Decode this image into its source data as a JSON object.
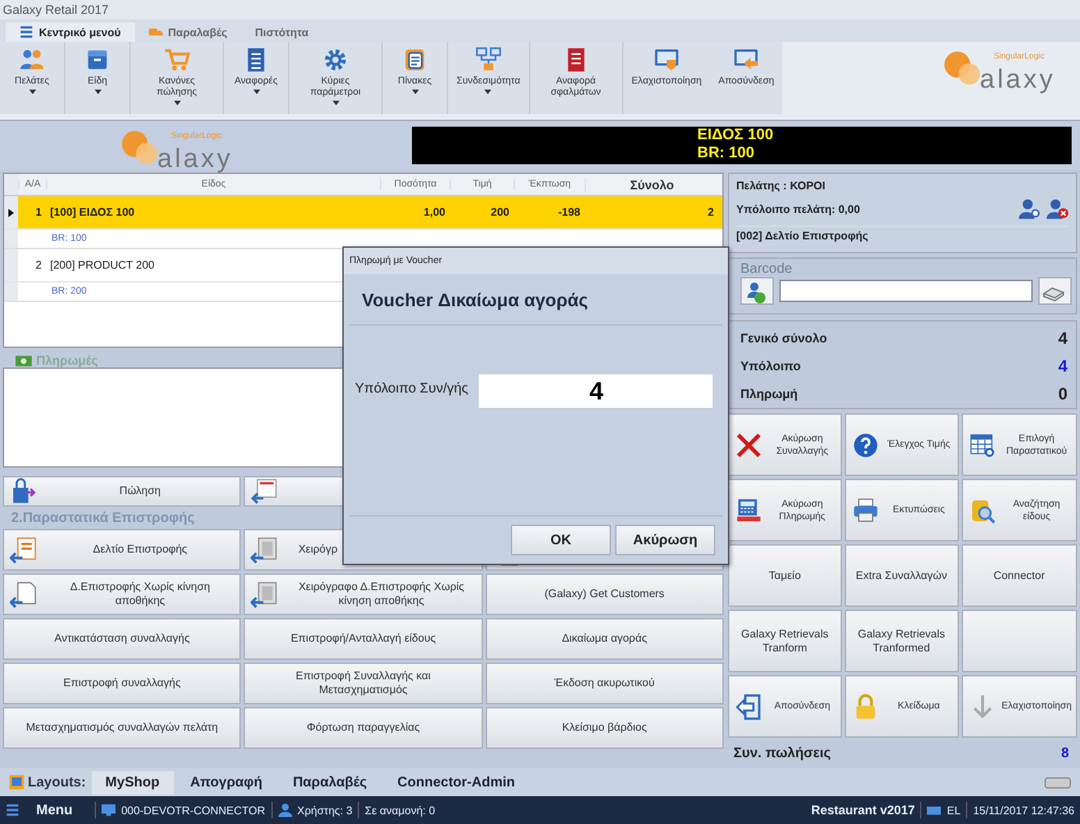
{
  "window": {
    "title": "Galaxy Retail 2017"
  },
  "ribbon_tabs": [
    {
      "label": "Κεντρικό μενού",
      "selected": true
    },
    {
      "label": "Παραλαβές",
      "selected": false
    },
    {
      "label": "Πιστότητα",
      "selected": false
    }
  ],
  "ribbon_buttons": [
    {
      "label": "Πελάτες",
      "dropdown": true
    },
    {
      "label": "Είδη",
      "dropdown": true
    },
    {
      "label": "Κανόνες πώλησης",
      "dropdown": true
    },
    {
      "label": "Αναφορές",
      "dropdown": true
    },
    {
      "label": "Κύριες παράμετροι",
      "dropdown": true
    },
    {
      "label": "Πίνακες",
      "dropdown": true
    },
    {
      "label": "Συνδεσιμότητα",
      "dropdown": true
    },
    {
      "label": "Αναφορά σφαλμάτων",
      "dropdown": false
    },
    {
      "label": "Ελαχιστοποίηση",
      "dropdown": false
    },
    {
      "label": "Αποσύνδεση",
      "dropdown": false
    }
  ],
  "ribbon_logo": {
    "maker": "SingularLogic",
    "brand": "alaxy"
  },
  "band_logo": {
    "maker": "SingularLogic",
    "brand": "alaxy"
  },
  "display": {
    "lines": [
      "ΕΙΔΟΣ 100",
      "BR: 100"
    ]
  },
  "grid": {
    "columns": [
      "Α/Α",
      "Είδος",
      "Ποσότητα",
      "Τιμή",
      "Έκπτωση",
      "Σύνολο"
    ],
    "rows": [
      {
        "aa": "1",
        "item": "[100] ΕΙΔΟΣ 100",
        "qty": "1,00",
        "price": "200",
        "discount": "-198",
        "total": "2",
        "br": "BR: 100",
        "selected": true
      },
      {
        "aa": "2",
        "item": "[200] PRODUCT 200",
        "br": "BR: 200",
        "selected": false
      }
    ]
  },
  "payments": {
    "title": "Πληρωμές"
  },
  "action_buttons": [
    {
      "kind": "icon",
      "label": "Πώληση"
    },
    {
      "kind": "covered"
    }
  ],
  "return_section": {
    "title": "2.Παραστατικά  Επιστροφής",
    "buttons": [
      {
        "kind": "icon",
        "label": "Δελτίο Επιστροφής"
      },
      {
        "kind": "icon",
        "label": "Χειρόγρ"
      },
      {
        "kind": "covered"
      },
      {
        "kind": "icon",
        "label": "Δ.Επιστροφής Χωρίς κίνηση αποθήκης"
      },
      {
        "kind": "icon",
        "label": "Χειρόγραφο Δ.Επιστροφής Χωρίς κίνηση αποθήκης"
      },
      {
        "kind": "text",
        "label": "(Galaxy) Get Customers"
      },
      {
        "kind": "text",
        "label": "Αντικατάσταση συναλλαγής"
      },
      {
        "kind": "text",
        "label": "Επιστροφή/Ανταλλαγή είδους"
      },
      {
        "kind": "text",
        "label": "Δικαίωμα αγοράς"
      },
      {
        "kind": "text",
        "label": "Επιστροφή συναλλαγής"
      },
      {
        "kind": "text",
        "label": "Επιστροφή Συναλλαγής και Μετασχηματισμός"
      },
      {
        "kind": "text",
        "label": "Έκδοση ακυρωτικού"
      },
      {
        "kind": "text",
        "label": "Μετασχηματισμός συναλλαγών πελάτη"
      },
      {
        "kind": "text",
        "label": "Φόρτωση παραγγελίας"
      },
      {
        "kind": "text",
        "label": "Κλείσιμο βάρδιος"
      }
    ]
  },
  "customer": {
    "name": "Πελάτης : ΚΟΡΟΙ",
    "balance": "Υπόλοιπο πελάτη: 0,00",
    "document": "[002] Δελτίο Επιστροφής"
  },
  "barcode": {
    "title": "Barcode"
  },
  "totals": [
    {
      "label": "Γενικό σύνολο",
      "value": "4",
      "color": "#222222"
    },
    {
      "label": "Υπόλοιπο",
      "value": "4",
      "color": "#1c1ccc"
    },
    {
      "label": "Πληρωμή",
      "value": "0",
      "color": "#222222"
    }
  ],
  "side_buttons": [
    {
      "kind": "icon",
      "label": "Ακύρωση Συναλλαγής"
    },
    {
      "kind": "icon",
      "label": "Έλεγχος Τιμής"
    },
    {
      "kind": "icon",
      "label": "Επιλογή Παραστατικού"
    },
    {
      "kind": "icon",
      "label": "Ακύρωση Πληρωμής"
    },
    {
      "kind": "icon",
      "label": "Εκτυπώσεις"
    },
    {
      "kind": "icon",
      "label": "Αναζήτηση είδους"
    },
    {
      "kind": "text",
      "label": "Ταμείο"
    },
    {
      "kind": "text",
      "label": "Extra Συναλλαγών"
    },
    {
      "kind": "text",
      "label": "Connector"
    },
    {
      "kind": "text",
      "label": "Galaxy Retrievals Tranform"
    },
    {
      "kind": "text",
      "label": "Galaxy Retrievals Tranformed"
    },
    {
      "kind": "blank"
    },
    {
      "kind": "icon",
      "label": "Αποσύνδεση"
    },
    {
      "kind": "icon",
      "label": "Κλείδωμα"
    },
    {
      "kind": "icon",
      "label": "Ελαχιστοποίηση"
    }
  ],
  "sales": {
    "label": "Συν. πωλήσεις",
    "value": "8"
  },
  "dialog": {
    "title": "Πληρωμή με Voucher",
    "heading": "Voucher Δικαίωμα αγοράς",
    "field_label": "Υπόλοιπο Συν/γής",
    "field_value": "4",
    "buttons": [
      "OK",
      "Ακύρωση"
    ]
  },
  "layouts": {
    "label": "Layouts:",
    "tabs": [
      {
        "label": "MyShop",
        "selected": true
      },
      {
        "label": "Απογραφή",
        "selected": false
      },
      {
        "label": "Παραλαβές",
        "selected": false
      },
      {
        "label": "Connector-Admin",
        "selected": false
      }
    ]
  },
  "status_bar": {
    "menu": "Menu",
    "terminal": "000-DEVOTR-CONNECTOR",
    "user": "Χρήστης: 3",
    "waiting": "Σε αναμονή: 0",
    "product": "Restaurant  v2017",
    "language": "EL",
    "datetime": "15/11/2017 12:47:36"
  }
}
